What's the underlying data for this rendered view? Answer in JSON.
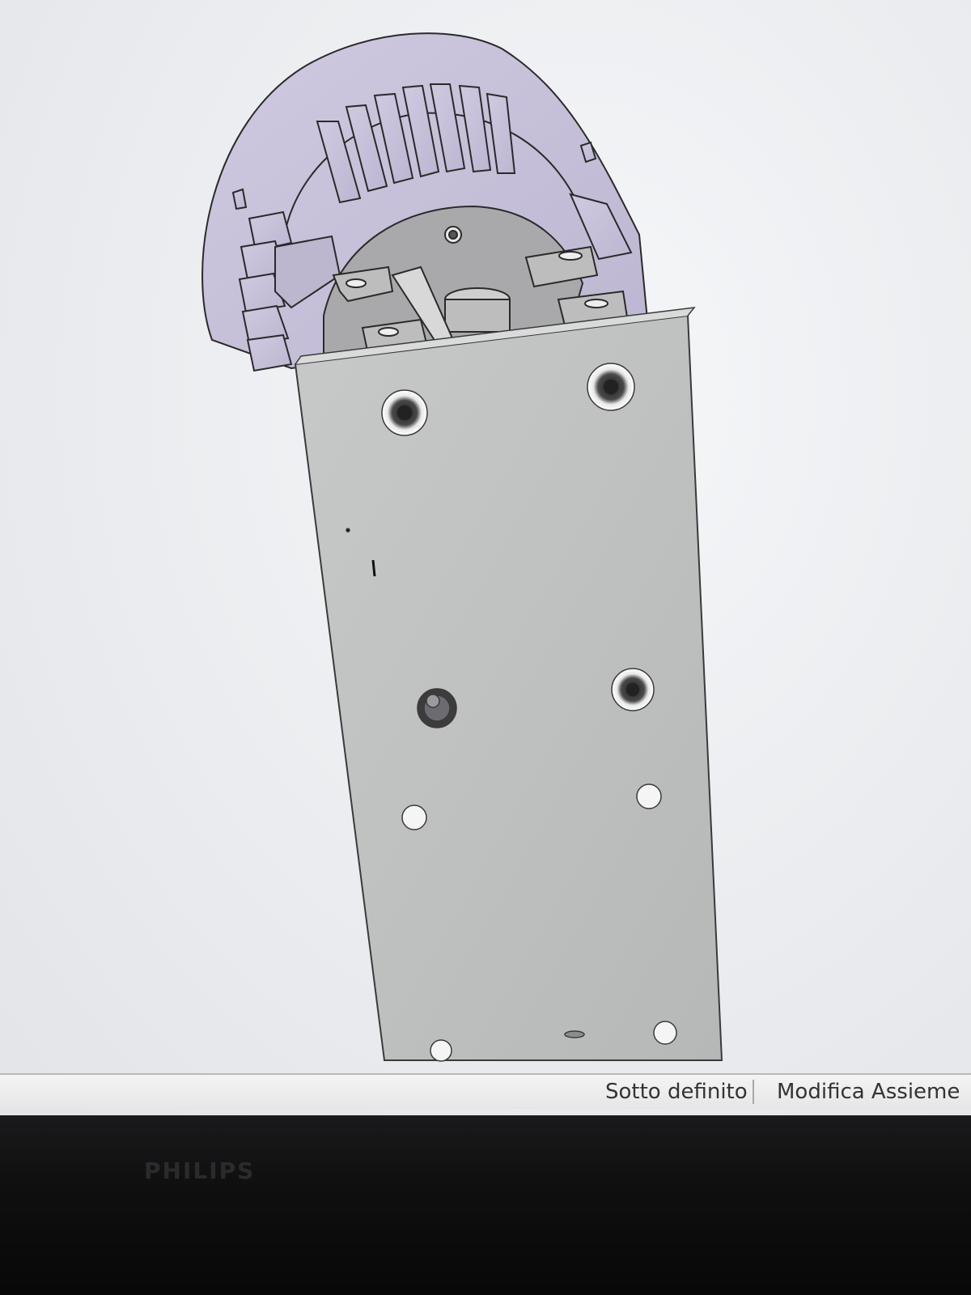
{
  "statusbar": {
    "definition_state": "Sotto definito",
    "edit_mode": "Modifica Assieme"
  },
  "bezel": {
    "brand": "PHILIPS"
  },
  "colors": {
    "motor_body": "#c9c3dc",
    "plate": "#c3c5c5",
    "bracket": "#b9b9b9",
    "outline": "#2a2a2a"
  },
  "icons": {
    "model": "motor-assembly-icon"
  }
}
